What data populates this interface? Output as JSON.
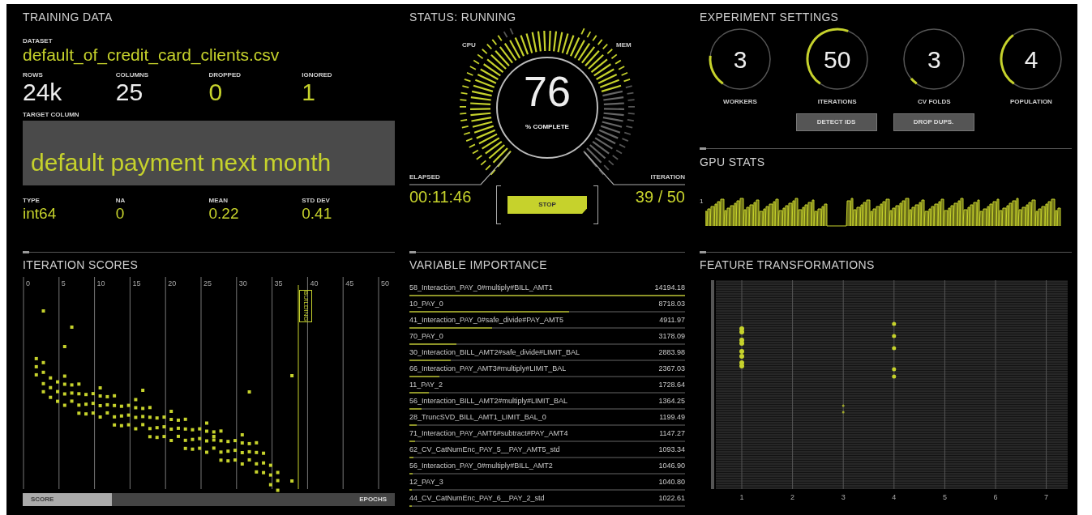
{
  "training_data": {
    "title": "TRAINING DATA",
    "dataset_label": "DATASET",
    "dataset": "default_of_credit_card_clients.csv",
    "counts": [
      {
        "label": "ROWS",
        "value": "24k",
        "kind": "neutral"
      },
      {
        "label": "COLUMNS",
        "value": "25",
        "kind": "neutral"
      },
      {
        "label": "DROPPED",
        "value": "0",
        "kind": "accent"
      },
      {
        "label": "IGNORED",
        "value": "1",
        "kind": "accent"
      }
    ],
    "target_label": "TARGET COLUMN",
    "target": "default payment next month",
    "stats": [
      {
        "label": "TYPE",
        "value": "int64"
      },
      {
        "label": "NA",
        "value": "0"
      },
      {
        "label": "MEAN",
        "value": "0.22"
      },
      {
        "label": "STD DEV",
        "value": "0.41"
      }
    ]
  },
  "status": {
    "title": "STATUS: RUNNING",
    "cpu": {
      "label": "CPU",
      "level": 0.92
    },
    "mem": {
      "label": "MEM",
      "level": 0.42
    },
    "progress": {
      "value": "76",
      "label": "% COMPLETE"
    },
    "elapsed": {
      "label": "ELAPSED",
      "value": "00:11:46"
    },
    "iteration": {
      "label": "ITERATION",
      "value": "39 / 50"
    },
    "stop_button": "STOP"
  },
  "experiment_settings": {
    "title": "EXPERIMENT SETTINGS",
    "dials": [
      {
        "value": "3",
        "label": "WORKERS",
        "level": 0.17
      },
      {
        "value": "50",
        "label": "ITERATIONS",
        "level": 0.46
      },
      {
        "value": "3",
        "label": "CV FOLDS",
        "level": 0.04
      },
      {
        "value": "4",
        "label": "POPULATION",
        "level": 0.3
      }
    ],
    "buttons": [
      "DETECT IDS",
      "DROP DUPS."
    ]
  },
  "gpu_stats": {
    "title": "GPU STATS",
    "axis_label": "1"
  },
  "iteration_scores": {
    "title": "ITERATION SCORES",
    "x_ticks": [
      "0",
      "5",
      "10",
      "15",
      "20",
      "25",
      "30",
      "35",
      "40",
      "45",
      "50"
    ],
    "marker": "BUILDING",
    "axis_toggle": [
      {
        "label": "SCORE",
        "selected": true
      },
      {
        "label": "EPOCHS",
        "selected": false
      }
    ]
  },
  "variable_importance": {
    "title": "VARIABLE IMPORTANCE",
    "rows": [
      {
        "name": "58_Interaction_PAY_0#multiply#BILL_AMT1",
        "value": "14194.18",
        "level": 1
      },
      {
        "name": "10_PAY_0",
        "value": "8718.03",
        "level": 0.58
      },
      {
        "name": "41_Interaction_PAY_0#safe_divide#PAY_AMT5",
        "value": "4911.97",
        "level": 0.3
      },
      {
        "name": "70_PAY_0",
        "value": "3178.09",
        "level": 0.17
      },
      {
        "name": "30_Interaction_BILL_AMT2#safe_divide#LIMIT_BAL",
        "value": "2883.98",
        "level": 0.15
      },
      {
        "name": "66_Interaction_PAY_AMT3#multiply#LIMIT_BAL",
        "value": "2367.03",
        "level": 0.11
      },
      {
        "name": "11_PAY_2",
        "value": "1728.64",
        "level": 0.07
      },
      {
        "name": "56_Interaction_BILL_AMT2#multiply#LIMIT_BAL",
        "value": "1364.25",
        "level": 0.045
      },
      {
        "name": "28_TruncSVD_BILL_AMT1_LIMIT_BAL_0",
        "value": "1199.49",
        "level": 0.025
      },
      {
        "name": "71_Interaction_PAY_AMT6#subtract#PAY_AMT4",
        "value": "1147.27",
        "level": 0.02
      },
      {
        "name": "62_CV_CatNumEnc_PAY_5__PAY_AMT5_std",
        "value": "1093.34",
        "level": 0.015
      },
      {
        "name": "56_Interaction_PAY_0#multiply#BILL_AMT2",
        "value": "1046.90",
        "level": 0.012
      },
      {
        "name": "12_PAY_3",
        "value": "1040.80",
        "level": 0.01
      },
      {
        "name": "44_CV_CatNumEnc_PAY_6__PAY_2_std",
        "value": "1022.61",
        "level": 0.01
      }
    ]
  },
  "feature_transformations": {
    "title": "FEATURE TRANSFORMATIONS",
    "x_ticks": [
      "1",
      "2",
      "3",
      "4",
      "5",
      "6",
      "7"
    ]
  }
}
